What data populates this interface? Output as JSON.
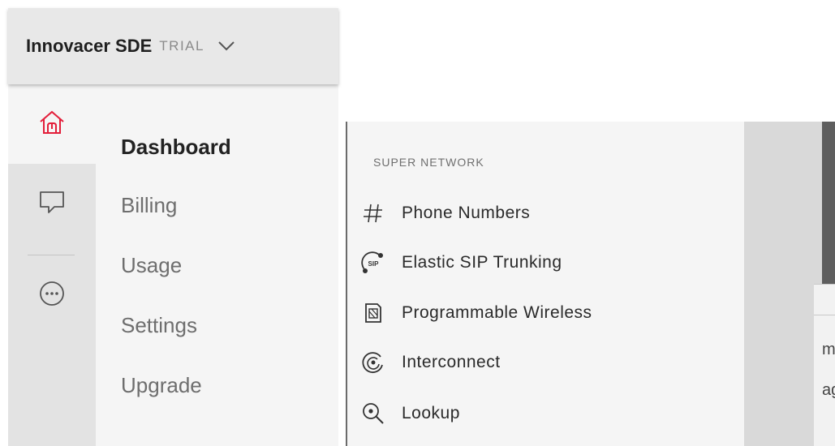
{
  "account": {
    "name": "Innovacer SDE",
    "badge": "TRIAL"
  },
  "icon_rail": [
    {
      "icon": "home-icon",
      "active": true
    },
    {
      "icon": "chat-icon",
      "active": false
    },
    {
      "icon": "more-icon",
      "active": false
    }
  ],
  "nav": {
    "items": [
      {
        "label": "Dashboard",
        "active": true
      },
      {
        "label": "Billing",
        "active": false
      },
      {
        "label": "Usage",
        "active": false
      },
      {
        "label": "Settings",
        "active": false
      },
      {
        "label": "Upgrade",
        "active": false
      }
    ]
  },
  "super_network": {
    "heading": "SUPER NETWORK",
    "items": [
      {
        "label": "Phone Numbers",
        "icon": "hash-icon"
      },
      {
        "label": "Elastic SIP Trunking",
        "icon": "sip-trunking-icon",
        "icon_text": "SIP"
      },
      {
        "label": "Programmable Wireless",
        "icon": "sim-card-icon"
      },
      {
        "label": "Interconnect",
        "icon": "interconnect-icon"
      },
      {
        "label": "Lookup",
        "icon": "lookup-icon"
      }
    ]
  },
  "overlay": {
    "fragments": [
      "m",
      "ag"
    ]
  },
  "colors": {
    "accent": "#e31e3a",
    "icon": "#555555"
  }
}
